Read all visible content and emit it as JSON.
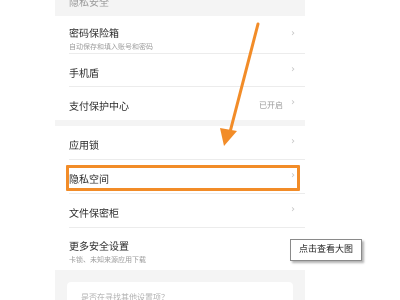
{
  "settings": {
    "top_cut_text": "隐私安全",
    "group1": [
      {
        "title": "密码保险箱",
        "subtitle": "自动保存和填入账号和密码",
        "status": ""
      },
      {
        "title": "手机盾",
        "subtitle": "",
        "status": ""
      },
      {
        "title": "支付保护中心",
        "subtitle": "",
        "status": "已开启"
      }
    ],
    "group2": [
      {
        "title": "应用锁",
        "subtitle": "",
        "status": ""
      },
      {
        "title": "隐私空间",
        "subtitle": "",
        "status": ""
      },
      {
        "title": "文件保密柜",
        "subtitle": "",
        "status": ""
      },
      {
        "title": "更多安全设置",
        "subtitle": "卡锁、未知来源应用下载",
        "status": ""
      }
    ],
    "bottom_card_text": "是否在寻找其他设置项？",
    "chevron": "›"
  },
  "overlay": {
    "tooltip": "点击查看大图",
    "highlight_color": "#f28c28",
    "arrow_color": "#f28c28"
  }
}
